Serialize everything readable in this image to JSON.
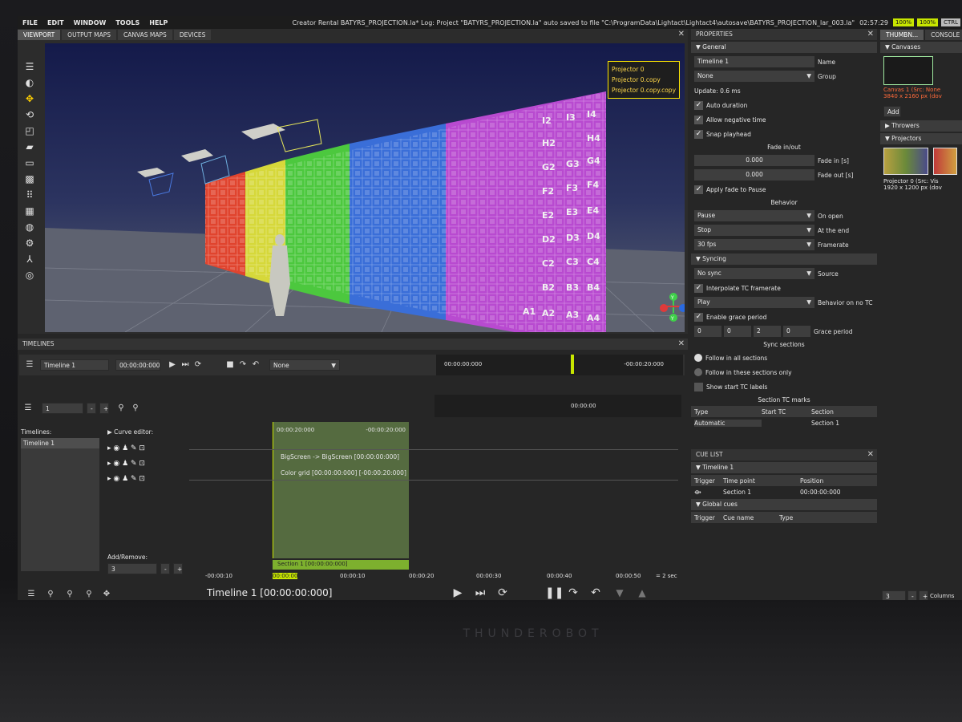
{
  "brand": "THUNDEROBOT",
  "menu": [
    "FILE",
    "EDIT",
    "WINDOW",
    "TOOLS",
    "HELP"
  ],
  "title": "Creator Rental  BATYRS_PROJECTION.la*   Log: Project \"BATYRS_PROJECTION.la\" auto saved to file \"C:\\ProgramData\\Lightact\\Lightact4\\autosave\\BATYRS_PROJECTION_lar_003.la\"",
  "clock": "02:57:29",
  "status_badges": [
    "100%",
    "100%",
    "CTRL"
  ],
  "viewport": {
    "tabs": [
      "VIEWPORT",
      "OUTPUT MAPS",
      "CANVAS MAPS",
      "DEVICES"
    ],
    "projectors": [
      "Projector 0",
      "Projector 0.copy",
      "Projector 0.copy.copy"
    ],
    "grid_labels": [
      "I2",
      "I3",
      "I4",
      "H2",
      "H4",
      "G2",
      "G3",
      "G4",
      "F2",
      "F3",
      "F4",
      "E2",
      "E3",
      "E4",
      "D2",
      "D3",
      "D4",
      "C2",
      "C3",
      "C4",
      "B2",
      "B3",
      "B4",
      "A1",
      "A2",
      "A3",
      "A4"
    ],
    "axis_labels": [
      "Y",
      "Y"
    ]
  },
  "timelines": {
    "title": "TIMELINES",
    "name": "Timeline 1",
    "time": "00:00:00:000",
    "group": "None",
    "ruler_start": "00:00:00:000",
    "ruler_end": "-00:00:20:000",
    "playhead": "00:00:00",
    "zoom_value": "1",
    "list_label": "Timelines:",
    "list_items": [
      "Timeline 1"
    ],
    "curve_editor": "Curve editor:",
    "clip_start": "00:00:20:000",
    "clip_end": "-00:00:20:000",
    "clip_rows": [
      "BigScreen -> BigScreen [00:00:00:000]",
      "Color grid [00:00:00:000]     [-00:00:20:000]"
    ],
    "section": "Section 1 [00:00:00:000]",
    "add_remove": "Add/Remove:",
    "add_value": "3",
    "ticks": [
      "-00:00:10",
      "00:00:00",
      "00:00:10",
      "00:00:20",
      "00:00:30",
      "00:00:40",
      "00:00:50"
    ],
    "scale": "= 2 sec",
    "footer": "Timeline 1 [00:00:00:000]"
  },
  "properties": {
    "title": "PROPERTIES",
    "general": "General",
    "name_value": "Timeline 1",
    "name_label": "Name",
    "group_value": "None",
    "group_label": "Group",
    "update": "Update: 0.6 ms",
    "checks": [
      "Auto duration",
      "Allow negative time",
      "Snap playhead"
    ],
    "fade_head": "Fade in/out",
    "fade_in": "0.000",
    "fade_in_label": "Fade in [s]",
    "fade_out": "0.000",
    "fade_out_label": "Fade out [s]",
    "apply_fade": "Apply fade to Pause",
    "behavior_head": "Behavior",
    "on_open": "Pause",
    "on_open_label": "On open",
    "at_end": "Stop",
    "at_end_label": "At the end",
    "fps": "30 fps",
    "fps_label": "Framerate",
    "syncing": "Syncing",
    "source": "No sync",
    "source_label": "Source",
    "interpolate": "Interpolate TC framerate",
    "no_tc": "Play",
    "no_tc_label": "Behavior on no TC",
    "grace": "Enable grace period",
    "grace_vals": [
      "0",
      "0",
      "2",
      "0"
    ],
    "grace_label": "Grace period",
    "sync_sections": "Sync sections",
    "follow_all": "Follow in all sections",
    "follow_these": "Follow in these sections only",
    "show_tc": "Show start TC labels",
    "section_tc": "Section TC marks",
    "cols": [
      "Type",
      "Start TC",
      "Section"
    ],
    "row": [
      "Automatic",
      "",
      "Section 1"
    ]
  },
  "cuelist": {
    "title": "CUE LIST",
    "timeline": "Timeline 1",
    "cols": [
      "Trigger",
      "Time point",
      "Position"
    ],
    "row": [
      "Section 1",
      "00:00:00:000"
    ],
    "global": "Global cues",
    "gcols": [
      "Trigger",
      "Cue name",
      "Type"
    ]
  },
  "thumbs": {
    "tabs": [
      "THUMBN...",
      "CONSOLE"
    ],
    "canvases": "Canvases",
    "canvas_name": "Canvas 1 (Src: None",
    "canvas_size": "3840 x 2160 px (dov",
    "add": "Add",
    "throwers": "Throwers",
    "projectors": "Projectors",
    "proj_name": "Projector 0 (Src: Vis",
    "proj_name2": "Projector",
    "proj_size": "1920 x 1200 px (dov",
    "columns_value": "3",
    "columns_label": "Columns"
  }
}
